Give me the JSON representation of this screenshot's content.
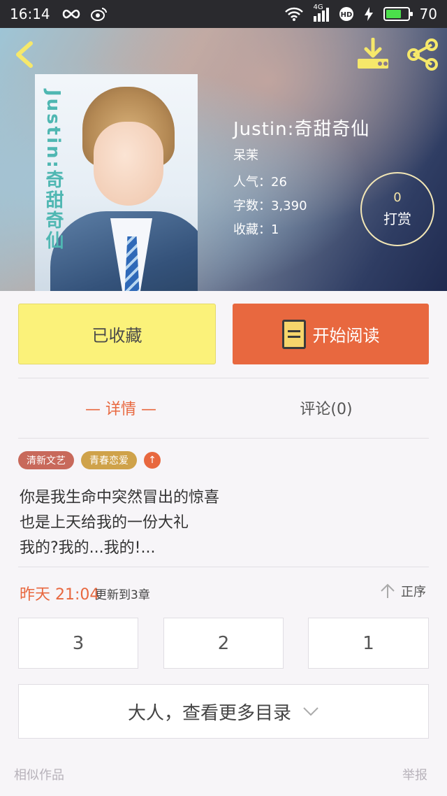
{
  "status_bar": {
    "time": "16:14",
    "network": "4G",
    "battery": "70",
    "battery_level": 0.7
  },
  "book": {
    "cover_title": "Justin:奇甜奇仙",
    "title": "Justin:奇甜奇仙",
    "author": "呆茉",
    "popularity": "人气：26",
    "word_count": "字数：3,390",
    "favorites": "收藏：1"
  },
  "reward": {
    "count": "0",
    "label": "打赏"
  },
  "actions": {
    "collected_label": "已收藏",
    "read_label": "开始阅读"
  },
  "tabs": {
    "detail": "— 详情 —",
    "comments": "评论(0)"
  },
  "tags": [
    "清新文艺",
    "青春恋爱"
  ],
  "tag_more": "↑",
  "intro_lines": [
    "你是我生命中突然冒出的惊喜",
    "也是上天给我的一份大礼",
    "我的?我的...我的!..."
  ],
  "update": {
    "time": "昨天 21:04",
    "text": "更新到3章",
    "order_label": "正序"
  },
  "chapters": [
    "3",
    "2",
    "1"
  ],
  "more_catalog": "大人，查看更多目录",
  "footer": {
    "similar": "相似作品",
    "report": "举报"
  },
  "colors": {
    "accent": "#e8683f",
    "collected_bg": "#fbf27a",
    "tag_1": "#c8695b",
    "tag_2": "#cfa24a"
  },
  "icons": [
    "back-icon",
    "download-icon",
    "share-icon",
    "book-icon",
    "arrow-up-icon",
    "chevron-down-icon",
    "wifi-icon",
    "signal-icon",
    "infinity-icon",
    "weibo-icon",
    "hd-icon",
    "charging-icon"
  ]
}
